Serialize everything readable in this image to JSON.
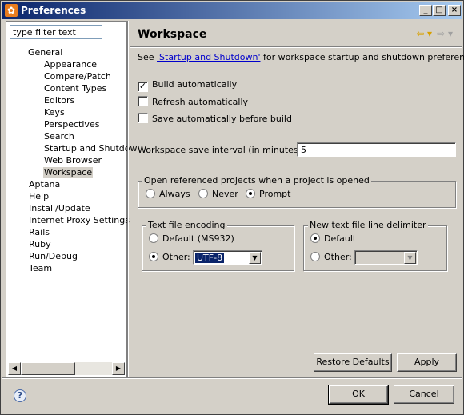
{
  "window": {
    "title": "Preferences",
    "icon": "preferences-gear-icon",
    "controls": {
      "minimize": "_",
      "maximize": "□",
      "close": "×"
    }
  },
  "sidebar": {
    "filter_placeholder": "type filter text",
    "filter_value": "type filter text",
    "tree": {
      "general": "General",
      "general_children": [
        "Appearance",
        "Compare/Patch",
        "Content Types",
        "Editors",
        "Keys",
        "Perspectives",
        "Search",
        "Startup and Shutdow",
        "Web Browser",
        "Workspace"
      ],
      "selected": "Workspace",
      "top_level": [
        "Aptana",
        "Help",
        "Install/Update",
        "Internet Proxy Settings",
        "Rails",
        "Ruby",
        "Run/Debug",
        "Team"
      ]
    }
  },
  "page": {
    "title": "Workspace",
    "see_prefix": "See ",
    "see_link": "'Startup and Shutdown'",
    "see_suffix": " for workspace startup and shutdown preferences.",
    "checkboxes": [
      {
        "label": "Build automatically",
        "checked": true
      },
      {
        "label": "Refresh automatically",
        "checked": false
      },
      {
        "label": "Save automatically before build",
        "checked": false
      }
    ],
    "save_interval_label": "Workspace save interval (in minutes):",
    "save_interval_value": "5",
    "open_projects": {
      "legend": "Open referenced projects when a project is opened",
      "options": [
        "Always",
        "Never",
        "Prompt"
      ],
      "selected": "Prompt"
    },
    "encoding": {
      "legend": "Text file encoding",
      "default_label": "Default (MS932)",
      "other_label": "Other:",
      "other_value": "UTF-8",
      "selected": "Other"
    },
    "line_delimiter": {
      "legend": "New text file line delimiter",
      "default_label": "Default",
      "other_label": "Other:",
      "other_value": "",
      "selected": "Default"
    },
    "restore_defaults": "Restore Defaults",
    "apply": "Apply"
  },
  "footer": {
    "help_icon": "help-icon",
    "ok": "OK",
    "cancel": "Cancel"
  }
}
